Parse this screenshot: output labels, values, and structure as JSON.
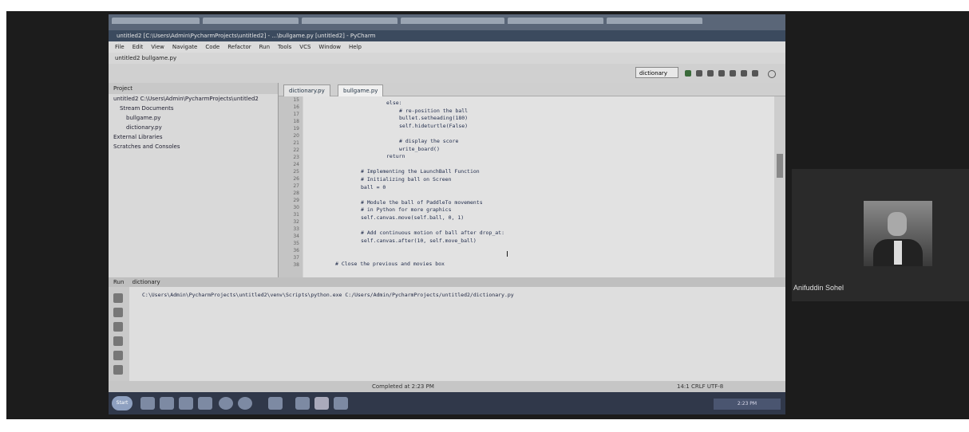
{
  "window": {
    "title": "untitled2 [C:\\Users\\Admin\\PycharmProjects\\untitled2] - ...\\bullgame.py [untitled2] - PyCharm",
    "breadcrumb": "untitled2  bullgame.py"
  },
  "menu": {
    "items": [
      "File",
      "Edit",
      "View",
      "Navigate",
      "Code",
      "Refactor",
      "Run",
      "Tools",
      "VCS",
      "Window",
      "Help"
    ]
  },
  "toolbar": {
    "run_config": "dictionary"
  },
  "project": {
    "header": "Project",
    "items": [
      "untitled2  C:\\Users\\Admin\\PycharmProjects\\untitled2",
      "Stream  Documents",
      "bullgame.py",
      "dictionary.py",
      "External Libraries",
      "Scratches and Consoles"
    ]
  },
  "editor": {
    "tabs": [
      "dictionary.py",
      "bullgame.py"
    ],
    "line_numbers": [
      "15",
      "16",
      "17",
      "18",
      "19",
      "20",
      "21",
      "22",
      "23",
      "24",
      "25",
      "26",
      "27",
      "28",
      "29",
      "30",
      "31",
      "32",
      "33",
      "34",
      "35",
      "36",
      "37",
      "38"
    ],
    "lines": [
      {
        "indent": 6,
        "text": "else:"
      },
      {
        "indent": 7,
        "text": "# re-position the ball"
      },
      {
        "indent": 7,
        "text": "bullet.setheading(180)"
      },
      {
        "indent": 7,
        "text": "self.hideturtle(False)"
      },
      {
        "indent": 0,
        "text": ""
      },
      {
        "indent": 7,
        "text": "# display the score"
      },
      {
        "indent": 7,
        "text": "write_board()"
      },
      {
        "indent": 6,
        "text": "return"
      },
      {
        "indent": 0,
        "text": ""
      },
      {
        "indent": 4,
        "text": "# Implementing the LaunchBall Function"
      },
      {
        "indent": 4,
        "text": "# Initializing ball on Screen"
      },
      {
        "indent": 4,
        "text": "ball = 0"
      },
      {
        "indent": 0,
        "text": ""
      },
      {
        "indent": 4,
        "text": "# Module the ball of PaddleTo movements"
      },
      {
        "indent": 4,
        "text": "# in Python for more graphics"
      },
      {
        "indent": 4,
        "text": "self.canvas.move(self.ball, 0, 1)"
      },
      {
        "indent": 0,
        "text": ""
      },
      {
        "indent": 4,
        "text": "# Add continuous motion of ball after drop_at:"
      },
      {
        "indent": 4,
        "text": "self.canvas.after(10, self.move_ball)"
      },
      {
        "indent": 0,
        "text": ""
      },
      {
        "indent": 0,
        "text": ""
      },
      {
        "indent": 2,
        "text": "# Close the previous and movies box"
      }
    ]
  },
  "run": {
    "tabs": [
      "Run",
      "dictionary"
    ],
    "command": "C:\\Users\\Admin\\PycharmProjects\\untitled2\\venv\\Scripts\\python.exe C:/Users/Admin/PycharmProjects/untitled2/dictionary.py"
  },
  "status": {
    "left": "Completed at 2:23 PM",
    "right": "14:1  CRLF  UTF-8"
  },
  "taskbar": {
    "start": "Start",
    "tray": "2:23 PM"
  },
  "participant": {
    "name": "Anifuddin Sohel"
  }
}
